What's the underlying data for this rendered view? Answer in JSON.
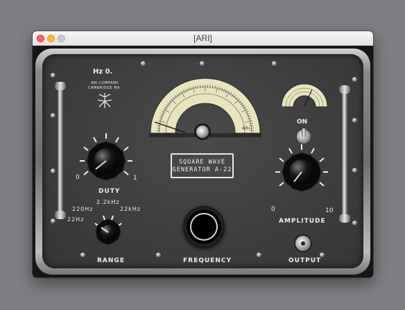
{
  "window": {
    "title": "[ARI]",
    "controls": [
      "close-button",
      "minimize-button",
      "maximize-button"
    ]
  },
  "brand": {
    "frequency_readout": "Hz 0.",
    "company_line1": "ARI COMPANY",
    "company_line2": "CAMBRIDGE MA.",
    "dial_mark": "ARI"
  },
  "panel": {
    "generator_line1": "SQUARE WAVE",
    "generator_line2": "GENERATOR A-22"
  },
  "controls": {
    "duty": {
      "label": "DUTY",
      "min": "0",
      "max": "1"
    },
    "range": {
      "label": "RANGE",
      "options": [
        "22Hz",
        "220Hz",
        "2.2kHz",
        "22kHz"
      ],
      "selected": "22Hz"
    },
    "frequency": {
      "label": "FREQUENCY"
    },
    "amplitude": {
      "label": "AMPLITUDE",
      "min": "0",
      "max": "10"
    },
    "power": {
      "label": "ON"
    },
    "output": {
      "label": "OUTPUT"
    }
  },
  "colors": {
    "panel": "#3e3e3e",
    "dial_face": "#e8e4bd",
    "label": "#eeeeee",
    "titlebar": "#ececec"
  }
}
